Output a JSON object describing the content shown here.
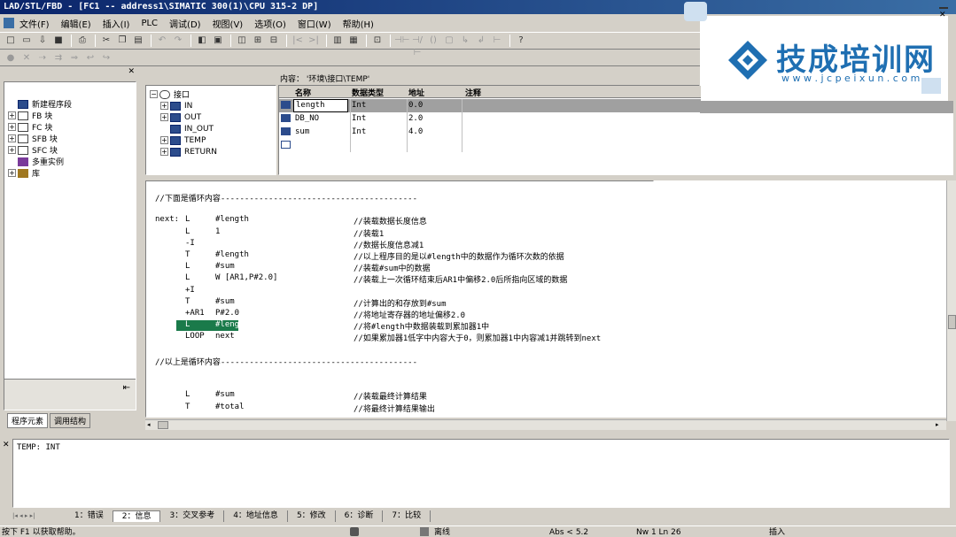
{
  "window": {
    "title": "LAD/STL/FBD  - [FC1 -- address1\\SIMATIC 300(1)\\CPU 315-2 DP]"
  },
  "menu": [
    "文件(F)",
    "编辑(E)",
    "插入(I)",
    "PLC",
    "调试(D)",
    "视图(V)",
    "选项(O)",
    "窗口(W)",
    "帮助(H)"
  ],
  "toolbar_icons": [
    "new-icon",
    "open-icon",
    "download-icon",
    "save-icon",
    "print-icon",
    "cut-icon",
    "copy-icon",
    "paste-icon",
    "undo-icon",
    "redo-icon",
    "monitor-icon",
    "online-icon",
    "offline-icon",
    "compile-icon",
    "reference-icon",
    "overview-icon",
    "details-icon",
    "help-icon"
  ],
  "left_panel": {
    "items": [
      {
        "label": "新建程序段",
        "expander": ""
      },
      {
        "label": "FB 块",
        "expander": "+"
      },
      {
        "label": "FC 块",
        "expander": "+"
      },
      {
        "label": "SFB 块",
        "expander": "+"
      },
      {
        "label": "SFC 块",
        "expander": "+"
      },
      {
        "label": "多重实例",
        "expander": ""
      },
      {
        "label": "库",
        "expander": "+"
      }
    ],
    "tabs": [
      "程序元素",
      "调用结构"
    ]
  },
  "interface": {
    "root": "接口",
    "items": [
      "IN",
      "OUT",
      "IN_OUT",
      "TEMP",
      "RETURN"
    ],
    "content_label": "内容：  '环境\\接口\\TEMP'",
    "columns": [
      "名称",
      "数据类型",
      "地址",
      "注释"
    ],
    "rows": [
      {
        "name": "length",
        "type": "Int",
        "addr": "0.0"
      },
      {
        "name": "DB_NO",
        "type": "Int",
        "addr": "2.0"
      },
      {
        "name": "sum",
        "type": "Int",
        "addr": "4.0"
      },
      {
        "name": "",
        "type": "",
        "addr": ""
      }
    ]
  },
  "code": {
    "lines": [
      {
        "label": "",
        "op": "//下面是循环内容-----------------------------------------",
        "arg": "",
        "comment": ""
      },
      {
        "label": "",
        "op": "",
        "arg": "",
        "comment": ""
      },
      {
        "label": "next:",
        "op": "L",
        "arg": "#length",
        "comment": "//装载数据长度信息"
      },
      {
        "label": "",
        "op": "L",
        "arg": "1",
        "comment": "//装载1"
      },
      {
        "label": "",
        "op": "-I",
        "arg": "",
        "comment": "//数据长度信息减1"
      },
      {
        "label": "",
        "op": "T",
        "arg": "#length",
        "comment": "//以上程序目的是以#length中的数据作为循环次数的依据"
      },
      {
        "label": "",
        "op": "L",
        "arg": "#sum",
        "comment": "//装载#sum中的数据"
      },
      {
        "label": "",
        "op": "L",
        "arg": "W [AR1,P#2.0]",
        "comment": "//装载上一次循环结束后AR1中偏移2.0后所指向区域的数据"
      },
      {
        "label": "",
        "op": "+I",
        "arg": "",
        "comment": ""
      },
      {
        "label": "",
        "op": "T",
        "arg": "#sum",
        "comment": "//计算出的和存放到#sum"
      },
      {
        "label": "",
        "op": "+AR1",
        "arg": "P#2.0",
        "comment": "//将地址寄存器的地址偏移2.0"
      },
      {
        "label": "",
        "op": "L",
        "arg": "#length",
        "comment": "//将#length中数据装载到累加器1中"
      },
      {
        "label": "",
        "op": "LOOP",
        "arg": "next",
        "comment": "//如果累加器1低字中内容大于0，则累加器1中内容减1并跳转到next"
      },
      {
        "label": "",
        "op": "",
        "arg": "",
        "comment": ""
      },
      {
        "label": "",
        "op": "//以上是循环内容-----------------------------------------",
        "arg": "",
        "comment": ""
      },
      {
        "label": "",
        "op": "",
        "arg": "",
        "comment": ""
      },
      {
        "label": "",
        "op": "",
        "arg": "",
        "comment": ""
      },
      {
        "label": "",
        "op": "L",
        "arg": "#sum",
        "comment": "//装载最终计算结果"
      },
      {
        "label": "",
        "op": "T",
        "arg": "#total",
        "comment": "//将最终计算结果输出"
      }
    ]
  },
  "output": {
    "text": "TEMP: INT",
    "tabs": [
      "1：错误",
      "2：信息",
      "3：交叉参考",
      "4：地址信息",
      "5：修改",
      "6：诊断",
      "7：比较"
    ]
  },
  "statusbar": {
    "help": "按下 F1 以获取帮助。",
    "mode": "离线",
    "abs": "Abs < 5.2",
    "pos": "Nw 1  Ln 26",
    "insert": "插入"
  },
  "overlay": {
    "brand": "技成培训网",
    "url": "w w w . j c p e i x u n . c o m"
  },
  "colors": {
    "titlebar": "#0a246a",
    "highlight": "#1a7a4a",
    "logo": "#1f6fb2"
  }
}
